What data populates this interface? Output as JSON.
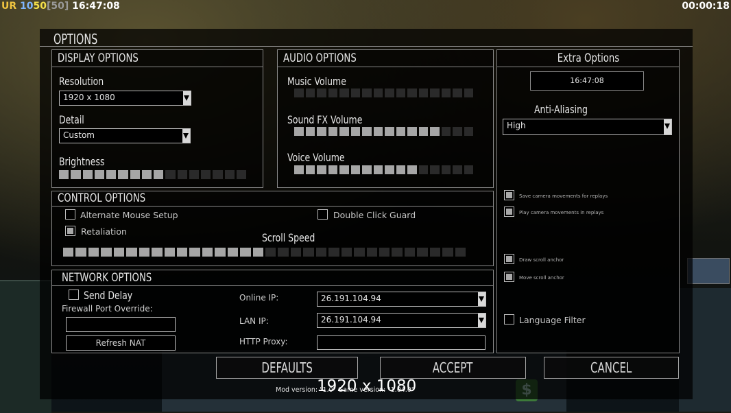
{
  "hud": {
    "ur": "UR",
    "n1": "10",
    "n2": "50",
    "n3": "[50]",
    "clock": "16:47:08",
    "timer": "00:00:18"
  },
  "title": "OPTIONS",
  "display": {
    "title": "DISPLAY OPTIONS",
    "resolution_label": "Resolution",
    "resolution_value": "1920 x 1080",
    "detail_label": "Detail",
    "detail_value": "Custom",
    "brightness_label": "Brightness",
    "brightness_level": 0.55
  },
  "audio": {
    "title": "AUDIO OPTIONS",
    "music_label": "Music Volume",
    "music_level": 0,
    "sfx_label": "Sound FX Volume",
    "sfx_level": 0.8,
    "voice_label": "Voice Volume",
    "voice_level": 0.7
  },
  "extra": {
    "title": "Extra Options",
    "clock": "16:47:08",
    "aa_label": "Anti-Aliasing",
    "aa_value": "High",
    "save_camera": "Save camera movements for replays",
    "play_camera": "Play camera movements in replays",
    "draw_scroll": "Draw scroll anchor",
    "move_scroll": "Move scroll anchor",
    "language_filter": "Language Filter"
  },
  "control": {
    "title": "CONTROL OPTIONS",
    "alt_mouse": "Alternate Mouse Setup",
    "double_click": "Double Click Guard",
    "retaliation": "Retaliation",
    "scroll_label": "Scroll Speed",
    "scroll_level": 0.5
  },
  "network": {
    "title": "NETWORK OPTIONS",
    "send_delay": "Send Delay",
    "firewall_label": "Firewall Port Override:",
    "firewall_value": "",
    "refresh_nat": "Refresh NAT",
    "online_ip_label": "Online IP:",
    "online_ip": "26.191.104.94",
    "lan_ip_label": "LAN IP:",
    "lan_ip": "26.191.104.94",
    "http_proxy_label": "HTTP Proxy:",
    "http_proxy": ""
  },
  "buttons": {
    "defaults": "DEFAULTS",
    "accept": "ACCEPT",
    "cancel": "CANCEL"
  },
  "footer": {
    "mod_version": "Mod version: \"1.0\"   Game version: \"1.04.0\"",
    "resolution_overlay": "1920 x 1080"
  }
}
